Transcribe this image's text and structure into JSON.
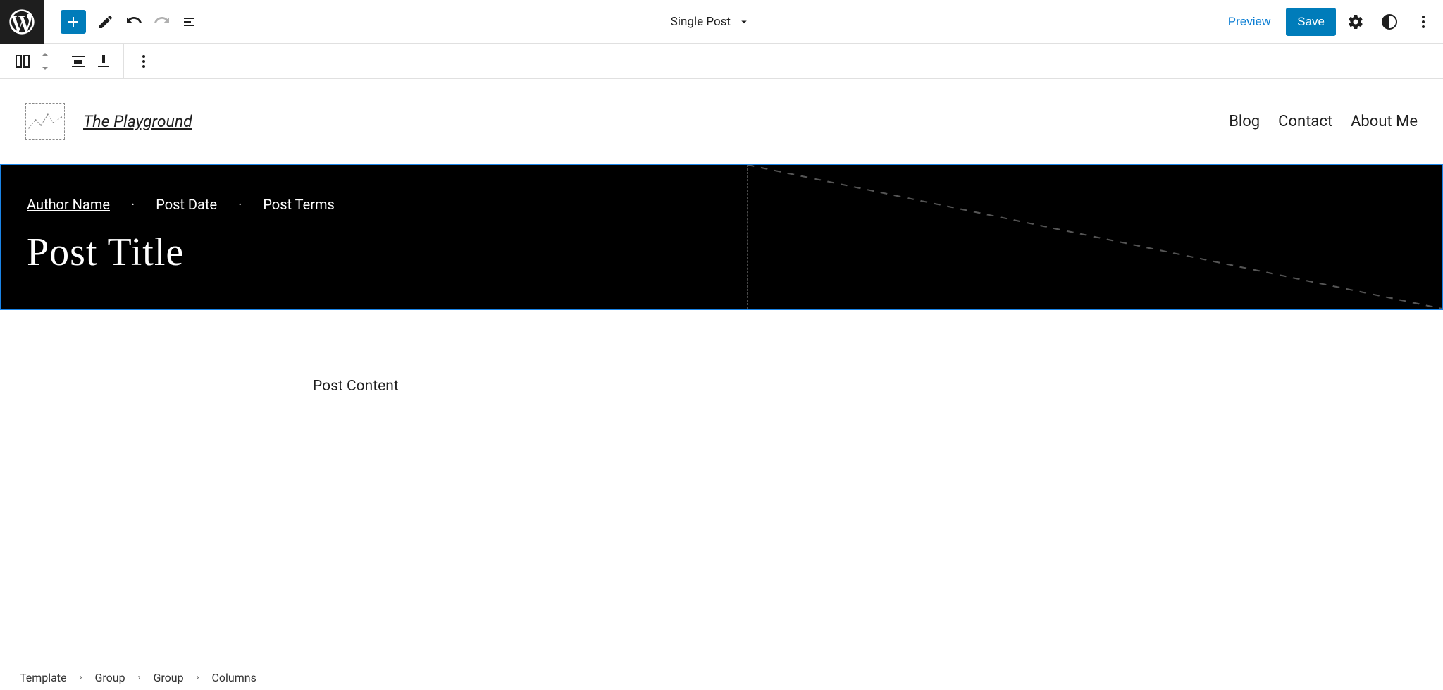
{
  "top": {
    "doc_title": "Single Post",
    "preview": "Preview",
    "save": "Save"
  },
  "site": {
    "title": "The Playground",
    "nav": {
      "a": "Blog",
      "b": "Contact",
      "c": "About Me"
    }
  },
  "post": {
    "meta": {
      "author": "Author Name",
      "sep": "·",
      "date": "Post Date",
      "terms": "Post Terms"
    },
    "title": "Post Title",
    "content": "Post Content"
  },
  "crumbs": {
    "a": "Template",
    "b": "Group",
    "c": "Group",
    "d": "Columns",
    "sep": "›"
  }
}
